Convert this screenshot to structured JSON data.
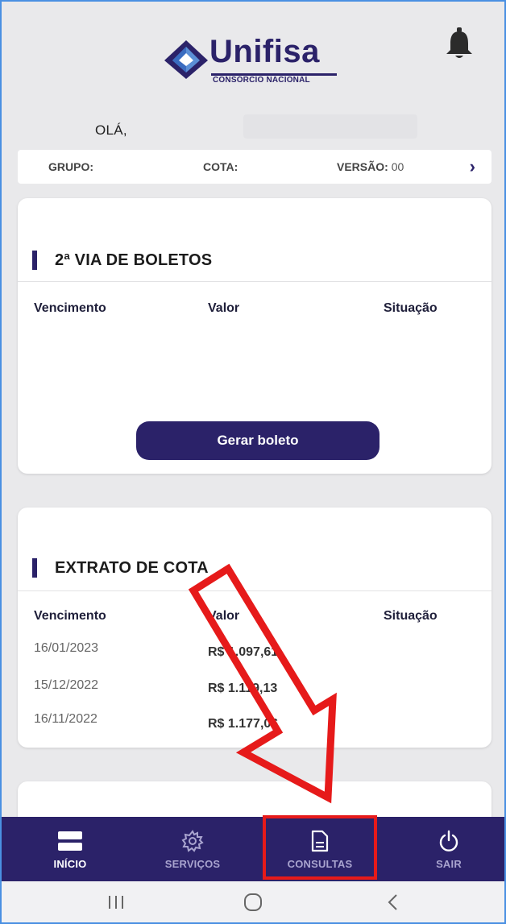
{
  "app": {
    "brand_name": "Unifisa",
    "brand_subtitle": "CONSÓRCIO NACIONAL",
    "brand_color": "#2b2269"
  },
  "header": {
    "greeting": "OLÁ,",
    "notification_icon": "bell-icon"
  },
  "info_bar": {
    "group_label": "GRUPO:",
    "quota_label": "COTA:",
    "version_label": "VERSÃO:",
    "version_value": "00",
    "chevron": "›"
  },
  "boletos_card": {
    "title": "2ª VIA DE BOLETOS",
    "columns": [
      "Vencimento",
      "Valor",
      "Situação"
    ],
    "button_label": "Gerar boleto"
  },
  "extrato_card": {
    "title": "EXTRATO DE COTA",
    "columns": [
      "Vencimento",
      "Valor",
      "Situação"
    ],
    "rows": [
      {
        "due": "16/01/2023",
        "value": "R$ 1.097,61",
        "status": ""
      },
      {
        "due": "15/12/2022",
        "value": "R$ 1.119,13",
        "status": ""
      },
      {
        "due": "16/11/2022",
        "value": "R$ 1.177,06",
        "status": ""
      }
    ]
  },
  "bottom_nav": {
    "items": [
      {
        "label": "INÍCIO",
        "icon": "home-menu-icon",
        "active": true
      },
      {
        "label": "SERVIÇOS",
        "icon": "gear-icon",
        "active": false
      },
      {
        "label": "CONSULTAS",
        "icon": "document-icon",
        "active": false
      },
      {
        "label": "SAIR",
        "icon": "power-icon",
        "active": false
      }
    ]
  },
  "system_nav": {
    "recents_icon": "recents-icon",
    "home_icon": "home-circle-icon",
    "back_icon": "back-icon"
  },
  "annotation": {
    "arrow_color": "#e61a1a",
    "highlight_target": "CONSULTAS"
  }
}
